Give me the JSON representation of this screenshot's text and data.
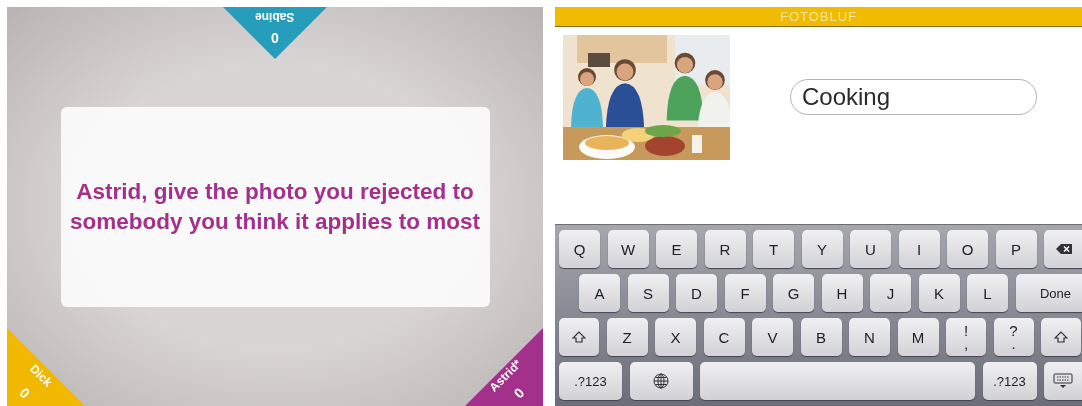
{
  "game": {
    "players": [
      {
        "name": "Sabine",
        "score": "0",
        "kind": "top",
        "color": "#259dbb"
      },
      {
        "name": "Dick",
        "score": "0",
        "kind": "left",
        "color": "#f0b800"
      },
      {
        "name": "Astrid*",
        "score": "0",
        "kind": "right",
        "color": "#a3308a"
      }
    ],
    "prompt": "Astrid, give the photo you rejected to somebody you think it applies to most"
  },
  "app": {
    "title": "FOTOBLUF",
    "photo": {
      "kind": "picture"
    },
    "answer": {
      "value": "Cooking"
    },
    "keyboard": [
      [
        {
          "kind": "letter",
          "label": "Q"
        },
        {
          "kind": "letter",
          "label": "W"
        },
        {
          "kind": "letter",
          "label": "E"
        },
        {
          "kind": "letter",
          "label": "R"
        },
        {
          "kind": "letter",
          "label": "T"
        },
        {
          "kind": "letter",
          "label": "Y"
        },
        {
          "kind": "letter",
          "label": "U"
        },
        {
          "kind": "letter",
          "label": "I"
        },
        {
          "kind": "letter",
          "label": "O"
        },
        {
          "kind": "letter",
          "label": "P"
        },
        {
          "kind": "backspace"
        }
      ],
      [
        {
          "kind": "letter",
          "label": "A"
        },
        {
          "kind": "letter",
          "label": "S"
        },
        {
          "kind": "letter",
          "label": "D"
        },
        {
          "kind": "letter",
          "label": "F"
        },
        {
          "kind": "letter",
          "label": "G"
        },
        {
          "kind": "letter",
          "label": "H"
        },
        {
          "kind": "letter",
          "label": "J"
        },
        {
          "kind": "letter",
          "label": "K"
        },
        {
          "kind": "letter",
          "label": "L"
        },
        {
          "kind": "wide",
          "label": "Done"
        }
      ],
      [
        {
          "kind": "shift"
        },
        {
          "kind": "letter",
          "label": "Z"
        },
        {
          "kind": "letter",
          "label": "X"
        },
        {
          "kind": "letter",
          "label": "C"
        },
        {
          "kind": "letter",
          "label": "V"
        },
        {
          "kind": "letter",
          "label": "B"
        },
        {
          "kind": "letter",
          "label": "N"
        },
        {
          "kind": "letter",
          "label": "M"
        },
        {
          "kind": "dual",
          "top": "!",
          "bottom": ","
        },
        {
          "kind": "dual",
          "top": "?",
          "bottom": "."
        },
        {
          "kind": "shift"
        }
      ],
      [
        {
          "kind": "mode",
          "label": ".?123"
        },
        {
          "kind": "globe"
        },
        {
          "kind": "space"
        },
        {
          "kind": "mode-short",
          "label": ".?123"
        },
        {
          "kind": "hide"
        }
      ]
    ]
  }
}
